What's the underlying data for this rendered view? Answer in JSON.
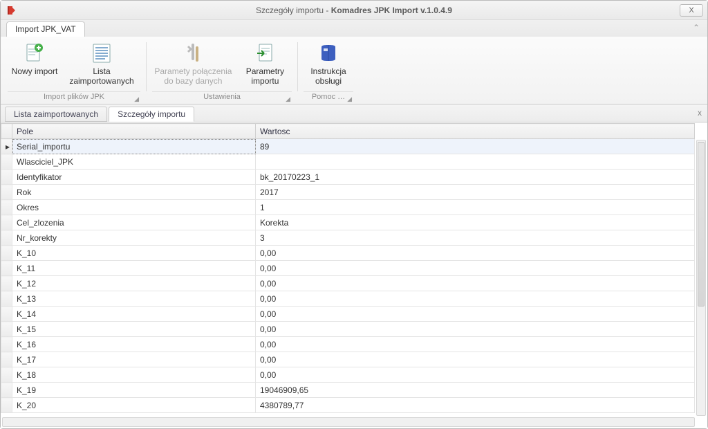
{
  "window": {
    "title_prefix": "Szczegóły importu - ",
    "title_bold": "Komadres JPK Import v.1.0.4.9",
    "close_glyph": "X"
  },
  "ribbon": {
    "tab_label": "Import JPK_VAT",
    "collapse_glyph": "⌃",
    "groups": {
      "import": {
        "caption": "Import plików JPK",
        "new_import": "Nowy import",
        "list_imported": "Lista\nzaimportowanych"
      },
      "settings": {
        "caption": "Ustawienia",
        "db_params": "Paramety połączenia\ndo bazy danych",
        "import_params": "Parametry\nimportu"
      },
      "help": {
        "caption": "Pomoc …",
        "manual": "Instrukcja\nobsługi"
      }
    }
  },
  "content_tabs": {
    "list_imported": "Lista zaimportowanych",
    "import_details": "Szczegóły importu",
    "close_glyph": "x"
  },
  "grid": {
    "col_field": "Pole",
    "col_value": "Wartosc",
    "rows": [
      {
        "field": "Serial_importu",
        "value": "89",
        "selected": true
      },
      {
        "field": "Wlasciciel_JPK",
        "value": ""
      },
      {
        "field": "Identyfikator",
        "value": "bk_20170223_1"
      },
      {
        "field": "Rok",
        "value": "2017"
      },
      {
        "field": "Okres",
        "value": "1"
      },
      {
        "field": "Cel_zlozenia",
        "value": "Korekta"
      },
      {
        "field": "Nr_korekty",
        "value": "3"
      },
      {
        "field": "K_10",
        "value": "0,00"
      },
      {
        "field": "K_11",
        "value": "0,00"
      },
      {
        "field": "K_12",
        "value": "0,00"
      },
      {
        "field": "K_13",
        "value": "0,00"
      },
      {
        "field": "K_14",
        "value": "0,00"
      },
      {
        "field": "K_15",
        "value": "0,00"
      },
      {
        "field": "K_16",
        "value": "0,00"
      },
      {
        "field": "K_17",
        "value": "0,00"
      },
      {
        "field": "K_18",
        "value": "0,00"
      },
      {
        "field": "K_19",
        "value": "19046909,65"
      },
      {
        "field": "K_20",
        "value": "4380789,77"
      }
    ]
  }
}
